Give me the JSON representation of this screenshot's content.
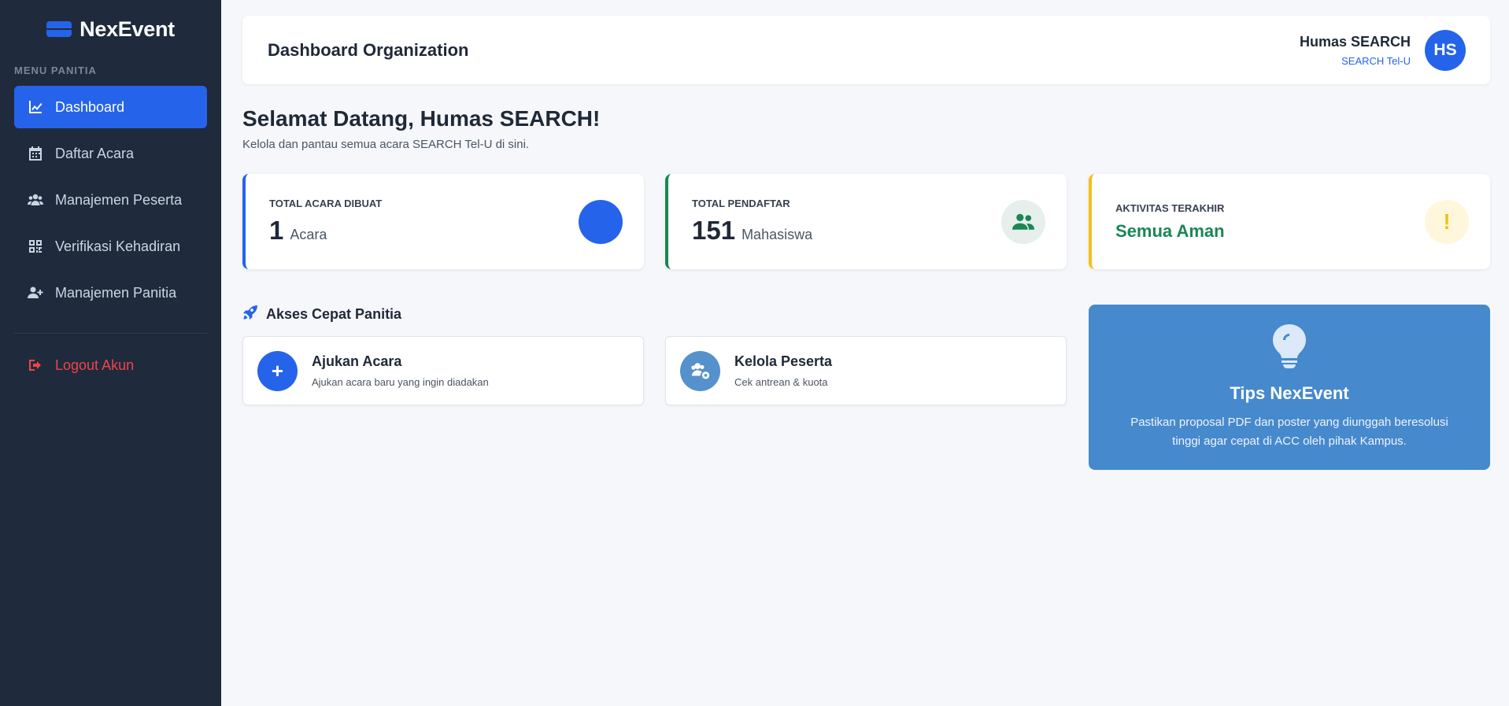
{
  "brand": {
    "name": "NexEvent"
  },
  "sidebar": {
    "section_label": "MENU PANITIA",
    "items": [
      {
        "label": "Dashboard",
        "icon": "chart-line-icon",
        "active": true
      },
      {
        "label": "Daftar Acara",
        "icon": "calendar-icon",
        "active": false
      },
      {
        "label": "Manajemen Peserta",
        "icon": "users-icon",
        "active": false
      },
      {
        "label": "Verifikasi Kehadiran",
        "icon": "qrcode-icon",
        "active": false
      },
      {
        "label": "Manajemen Panitia",
        "icon": "user-plus-icon",
        "active": false
      }
    ],
    "logout_label": "Logout Akun"
  },
  "header": {
    "title": "Dashboard Organization",
    "user_name": "Humas SEARCH",
    "user_org": "SEARCH Tel-U",
    "avatar_initials": "HS"
  },
  "welcome": {
    "title": "Selamat Datang, Humas SEARCH!",
    "subtitle": "Kelola dan pantau semua acara SEARCH Tel-U di sini."
  },
  "stats": [
    {
      "label": "TOTAL ACARA DIBUAT",
      "value": "1",
      "unit": "Acara",
      "accent": "#2563eb"
    },
    {
      "label": "TOTAL PENDAFTAR",
      "value": "151",
      "unit": "Mahasiswa",
      "accent": "#198754"
    },
    {
      "label": "AKTIVITAS TERAKHIR",
      "status": "Semua Aman",
      "icon_glyph": "!",
      "accent": "#f4c01a"
    }
  ],
  "quick_access": {
    "title": "Akses Cepat Panitia",
    "cards": [
      {
        "title": "Ajukan Acara",
        "description": "Ajukan acara baru yang ingin diadakan",
        "icon_glyph": "+"
      },
      {
        "title": "Kelola Peserta",
        "description": "Cek antrean & kuota"
      }
    ]
  },
  "tips": {
    "title": "Tips NexEvent",
    "text": "Pastikan proposal PDF dan poster yang diunggah beresolusi tinggi agar cepat di ACC oleh pihak Kampus."
  },
  "colors": {
    "sidebar_bg": "#1f2a3c",
    "primary": "#2563eb",
    "success": "#198754",
    "warning": "#f4c01a",
    "danger": "#f0444a",
    "tips_bg": "#4689cd"
  }
}
